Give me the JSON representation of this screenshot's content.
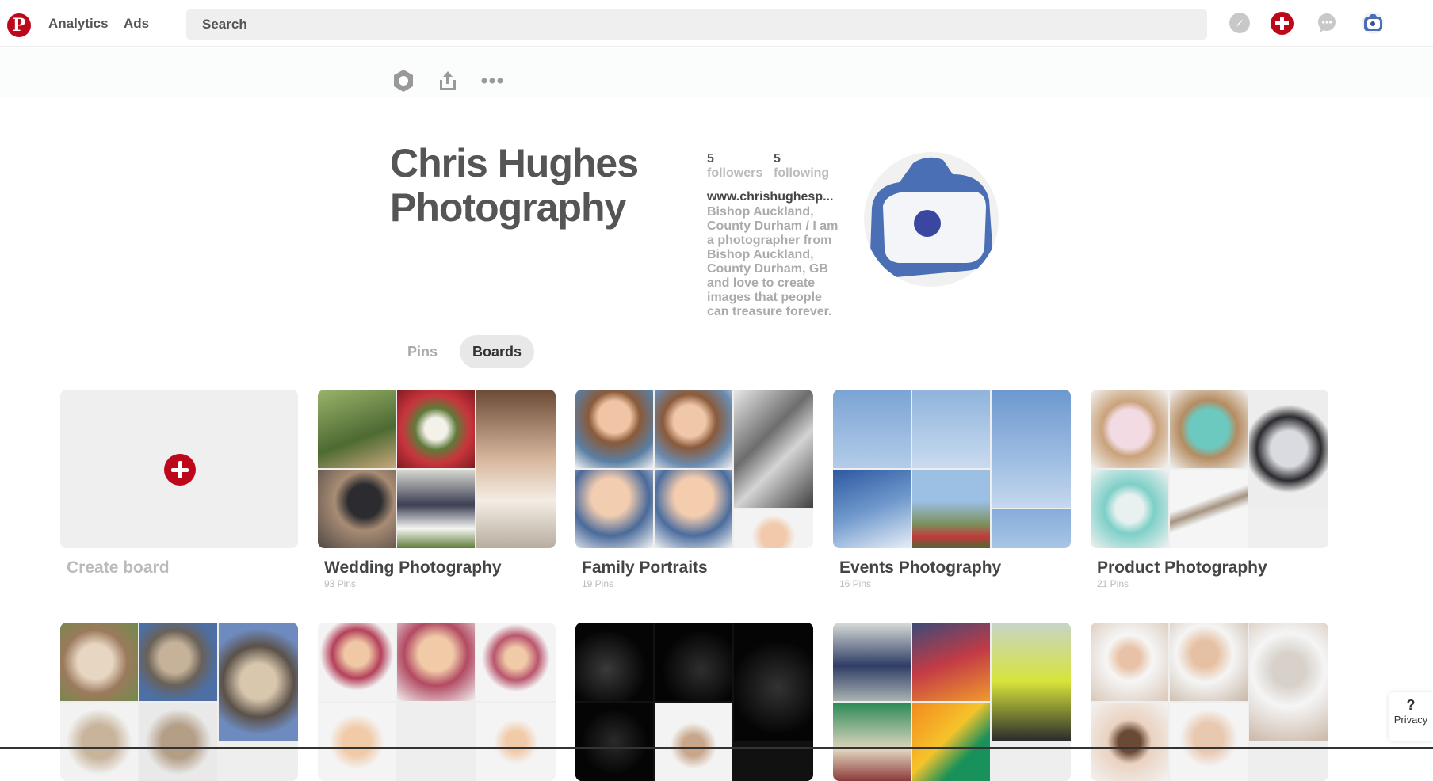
{
  "header": {
    "logo_letter": "P",
    "nav": [
      "Analytics",
      "Ads"
    ],
    "search_placeholder": "Search",
    "icons": [
      "compass-icon",
      "add-icon",
      "messages-icon",
      "profile-avatar-icon"
    ]
  },
  "toolbar": {
    "icons": [
      "settings-icon",
      "share-icon",
      "more-icon"
    ]
  },
  "profile": {
    "name_line1": "Chris Hughes",
    "name_line2": "Photography",
    "followers_count": "5",
    "followers_label": "followers",
    "following_count": "5",
    "following_label": "following",
    "website": "www.chrishughesp...",
    "bio": "Bishop Auckland, County Durham / I am a photographer from Bishop Auckland, County Durham, GB and love to create images that people can treasure forever."
  },
  "tabs": [
    {
      "label": "Pins",
      "active": false
    },
    {
      "label": "Boards",
      "active": true
    }
  ],
  "create_board_label": "Create board",
  "boards": [
    {
      "title": "Wedding Photography",
      "count": "93 Pins"
    },
    {
      "title": "Family Portraits",
      "count": "19 Pins"
    },
    {
      "title": "Events Photography",
      "count": "16 Pins"
    },
    {
      "title": "Product Photography",
      "count": "21 Pins"
    }
  ],
  "privacy": {
    "icon": "?",
    "label": "Privacy"
  },
  "colors": {
    "brand_red": "#bd081c",
    "avatar_blue": "#4a6fb5"
  }
}
